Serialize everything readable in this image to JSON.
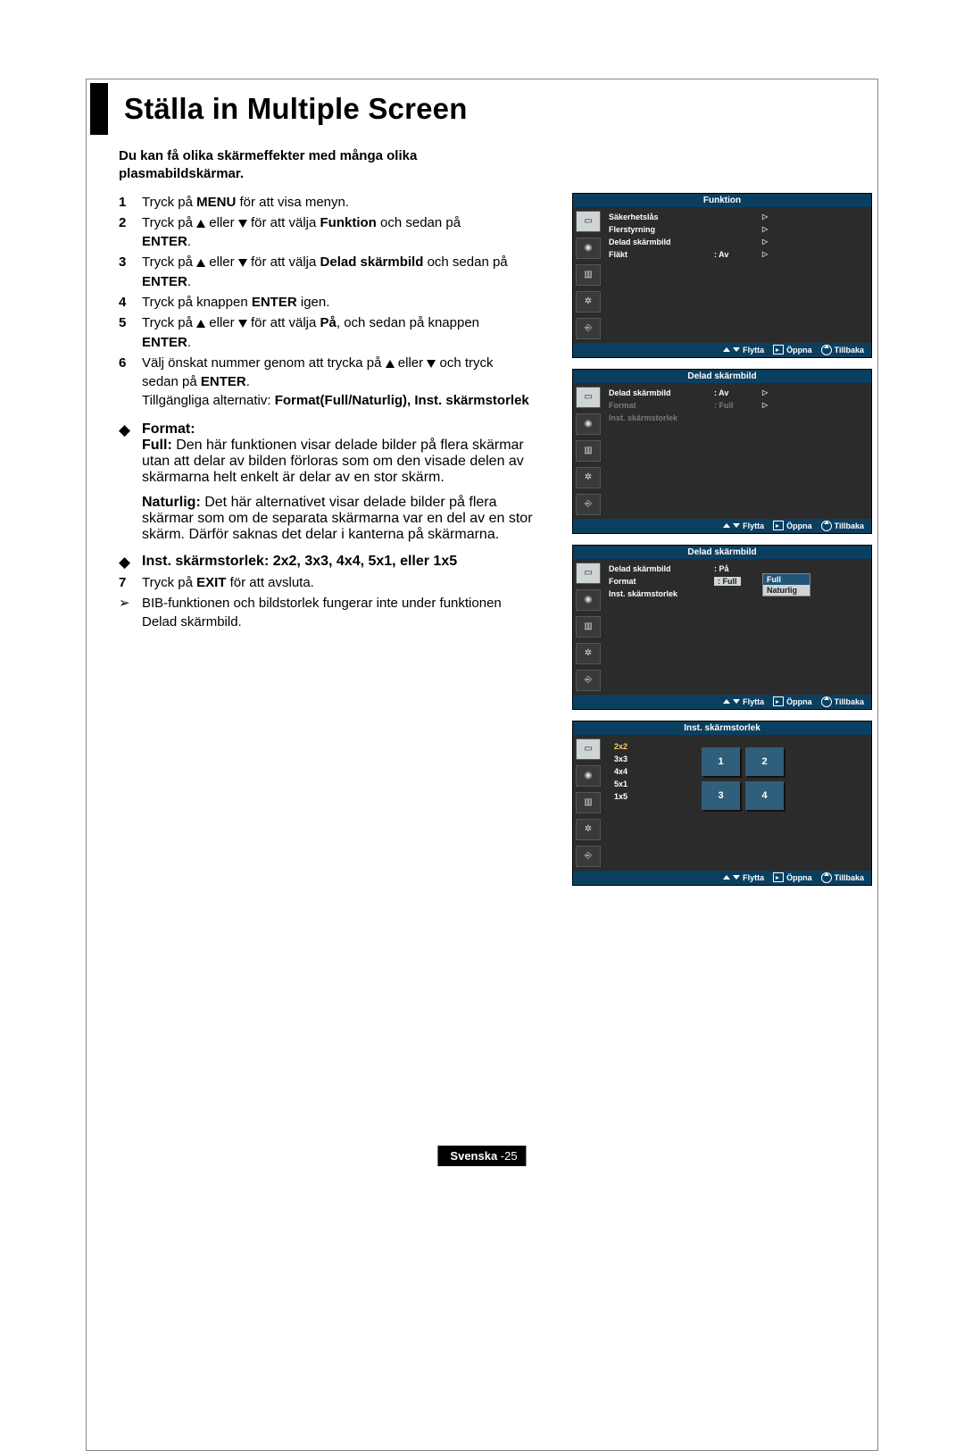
{
  "title": "Ställa in Multiple Screen",
  "intro": "Du kan få olika skärmeffekter med många olika plasmabildskärmar.",
  "steps": {
    "s1": "Tryck på MENU för att visa menyn.",
    "s1_menu": "MENU",
    "s2a": "Tryck på ",
    "s2b": " eller ",
    "s2c": " för att välja ",
    "s2_funk": "Funktion",
    "s2d": " och sedan på ",
    "s2_enter": "ENTER",
    "s3a": "Tryck på ",
    "s3b": " eller ",
    "s3c": " för att välja ",
    "s3_ds": "Delad skärmbild",
    "s3d": " och sedan på ",
    "s3_enter": "ENTER",
    "s4a": "Tryck på knappen ",
    "s4_enter": "ENTER",
    "s4b": " igen.",
    "s5a": "Tryck på ",
    "s5b": " eller ",
    "s5c": " för att välja ",
    "s5_pa": "På",
    "s5d": ", och sedan på knappen ",
    "s5_enter": "ENTER",
    "s6a": "Välj önskat nummer genom att trycka på ",
    "s6b": " eller ",
    "s6c": " och tryck sedan på ",
    "s6_enter": "ENTER",
    "s6d": "Tillgängliga alternativ: ",
    "s6_opts": "Format(Full/Naturlig), Inst. skärmstorlek",
    "format_h": "Format:",
    "format_full_h": "Full:",
    "format_full_t": " Den här funktionen visar delade bilder på flera skärmar utan att delar av bilden förloras som om den visade delen av skärmarna helt enkelt är delar av en stor skärm.",
    "format_nat_h": "Naturlig:",
    "format_nat_t": " Det här alternativet visar delade bilder på flera skärmar som om de separata skärmarna var en del av en stor skärm. Därför saknas det delar i kanterna på skärmarna.",
    "inst_h": "Inst. skärmstorlek: 2x2, 3x3, 4x4, 5x1, eller 1x5",
    "s7a": "Tryck på ",
    "s7_exit": "EXIT",
    "s7b": " för att avsluta.",
    "note": "BIB-funktionen och bildstorlek fungerar inte under funktionen Delad skärmbild."
  },
  "osd_foot": {
    "flytta": "Flytta",
    "oppna": "Öppna",
    "tillbaka": "Tillbaka"
  },
  "osd1": {
    "hdr": "Funktion",
    "r1": "Säkerhetslås",
    "r2": "Flerstyrning",
    "r3": "Delad skärmbild",
    "r4": "Fläkt",
    "r4v": ": Av"
  },
  "osd2": {
    "hdr": "Delad skärmbild",
    "r1": "Delad skärmbild",
    "r1v": ": Av",
    "r2": "Format",
    "r2v": ": Full",
    "r3": "Inst. skärmstorlek"
  },
  "osd3": {
    "hdr": "Delad skärmbild",
    "r1": "Delad skärmbild",
    "r1v": ": På",
    "r2": "Format",
    "r2v": ": Full",
    "r3": "Inst. skärmstorlek",
    "dd1": "Full",
    "dd2": "Naturlig"
  },
  "osd4": {
    "hdr": "Inst. skärmstorlek",
    "sizes": [
      "2x2",
      "3x3",
      "4x4",
      "5x1",
      "1x5"
    ],
    "cells": [
      "1",
      "2",
      "3",
      "4"
    ]
  },
  "footer": {
    "lang": "Svenska ",
    "pn": "-25"
  }
}
